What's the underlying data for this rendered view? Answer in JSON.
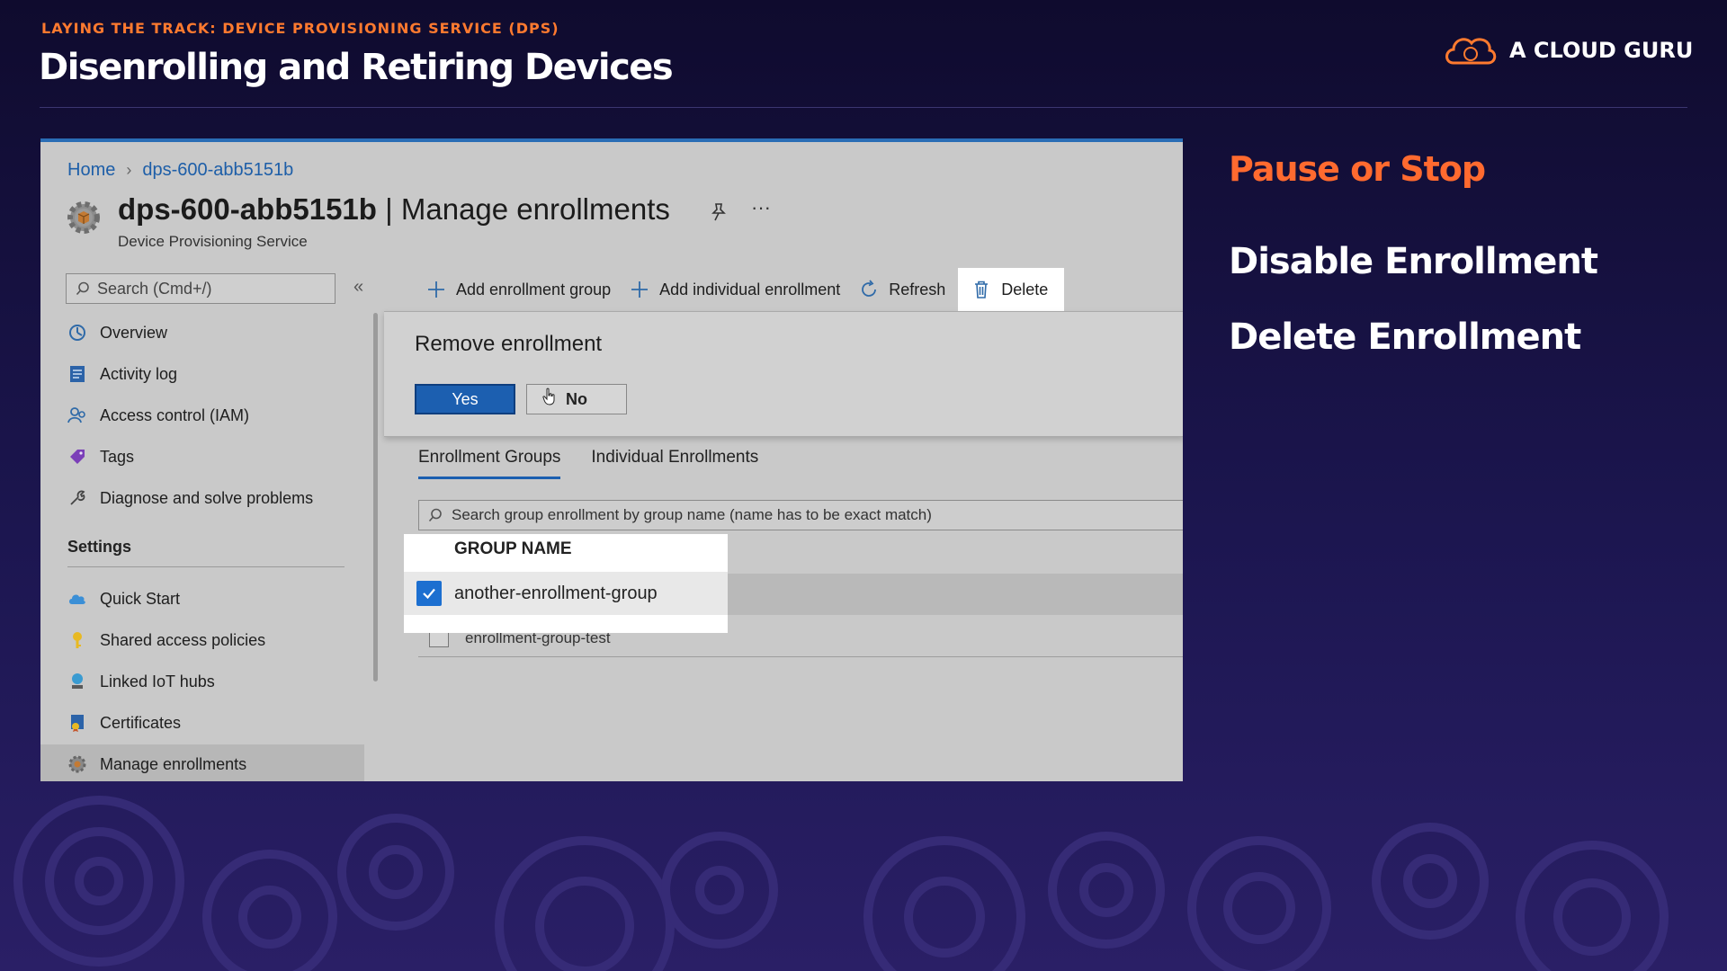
{
  "slide": {
    "kicker": "LAYING THE TRACK: DEVICE PROVISIONING SERVICE (DPS)",
    "title": "Disenrolling and Retiring Devices",
    "brand": "A CLOUD GURU"
  },
  "notes": {
    "heading": "Pause or Stop",
    "points": [
      "Disable Enrollment",
      "Delete Enrollment"
    ]
  },
  "portal": {
    "breadcrumb": [
      "Home",
      "dps-600-abb5151b"
    ],
    "resource_name": "dps-600-abb5151b",
    "title_sep": " | ",
    "blade_title": "Manage enrollments",
    "subtitle": "Device Provisioning Service",
    "more": "···",
    "search_placeholder": "Search (Cmd+/)",
    "collapse": "«",
    "nav": [
      {
        "label": "Overview",
        "icon": "overview-icon"
      },
      {
        "label": "Activity log",
        "icon": "activity-log-icon"
      },
      {
        "label": "Access control (IAM)",
        "icon": "access-control-icon"
      },
      {
        "label": "Tags",
        "icon": "tag-icon"
      },
      {
        "label": "Diagnose and solve problems",
        "icon": "wrench-icon"
      }
    ],
    "settings_header": "Settings",
    "settings": [
      {
        "label": "Quick Start",
        "icon": "cloud-icon"
      },
      {
        "label": "Shared access policies",
        "icon": "key-icon"
      },
      {
        "label": "Linked IoT hubs",
        "icon": "iot-hub-icon"
      },
      {
        "label": "Certificates",
        "icon": "certificate-icon"
      },
      {
        "label": "Manage enrollments",
        "icon": "gear-icon",
        "active": true
      }
    ],
    "toolbar": {
      "add_group": "Add enrollment group",
      "add_individual": "Add individual enrollment",
      "refresh": "Refresh",
      "delete": "Delete"
    },
    "confirm": {
      "question": "Remove enrollment",
      "yes": "Yes",
      "no": "No"
    },
    "tabs": [
      "Enrollment Groups",
      "Individual Enrollments"
    ],
    "grid_search_placeholder": "Search group enrollment by group name (name has to be exact match)",
    "column_header": "GROUP NAME",
    "rows": [
      {
        "name": "another-enrollment-group",
        "checked": true
      },
      {
        "name": "enrollment-group-test",
        "checked": false
      }
    ]
  },
  "colors": {
    "accent_orange": "#ff6a2f",
    "azure_blue": "#1c5fb0",
    "background": "#1c1650"
  }
}
